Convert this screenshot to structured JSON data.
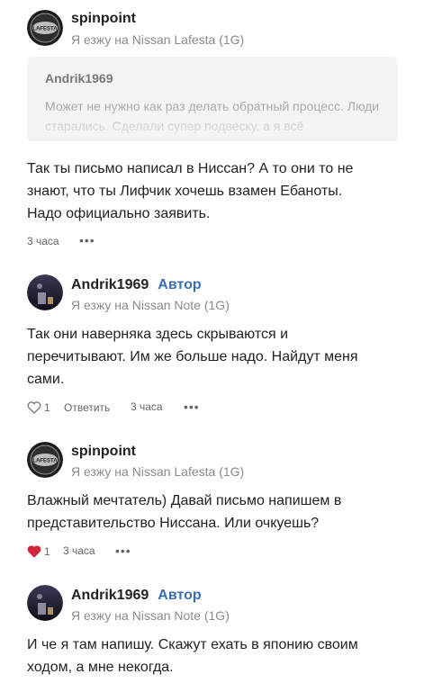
{
  "comments": [
    {
      "author": "spinpoint",
      "car": "Я езжу на Nissan Lafesta (1G)",
      "avatar_text": "LAFESTA",
      "quote": {
        "author": "Andrik1969",
        "text": "Может не нужно как раз делать обратный процесс. Люди старались. Сделали супер подвеску, а я всё"
      },
      "lines": [
        "Так ты письмо написал в Ниссан? А то они то не",
        "знают, что ты Лифчик хочешь взамен Ебаноты.",
        "Надо официально заявить."
      ],
      "time": "3 часа",
      "more": "•••"
    },
    {
      "author": "Andrik1969",
      "badge": "Автор",
      "car": "Я езжу на Nissan Note (1G)",
      "lines": [
        "Так они наверняка здесь скрываются и",
        "перечитывают. Им же больше надо. Найдут меня",
        "сами."
      ],
      "likes": "1",
      "reply": "Ответить",
      "time": "3 часа",
      "more": "•••"
    },
    {
      "author": "spinpoint",
      "car": "Я езжу на Nissan Lafesta (1G)",
      "avatar_text": "LAFESTA",
      "lines": [
        "Влажный мечтатель) Давай письмо напишем в",
        "представительство Ниссана. Или очкуешь?"
      ],
      "likes": "1",
      "time": "3 часа",
      "more": "•••"
    },
    {
      "author": "Andrik1969",
      "badge": "Автор",
      "car": "Я езжу на Nissan Note (1G)",
      "lines": [
        "И че я там напишу. Скажут ехать в японию своим",
        "ходом, а мне некогда."
      ]
    }
  ],
  "colors": {
    "author_badge": "#3a6fb7",
    "liked_heart": "#d0243a",
    "quote_bg": "#f4f4f4"
  }
}
